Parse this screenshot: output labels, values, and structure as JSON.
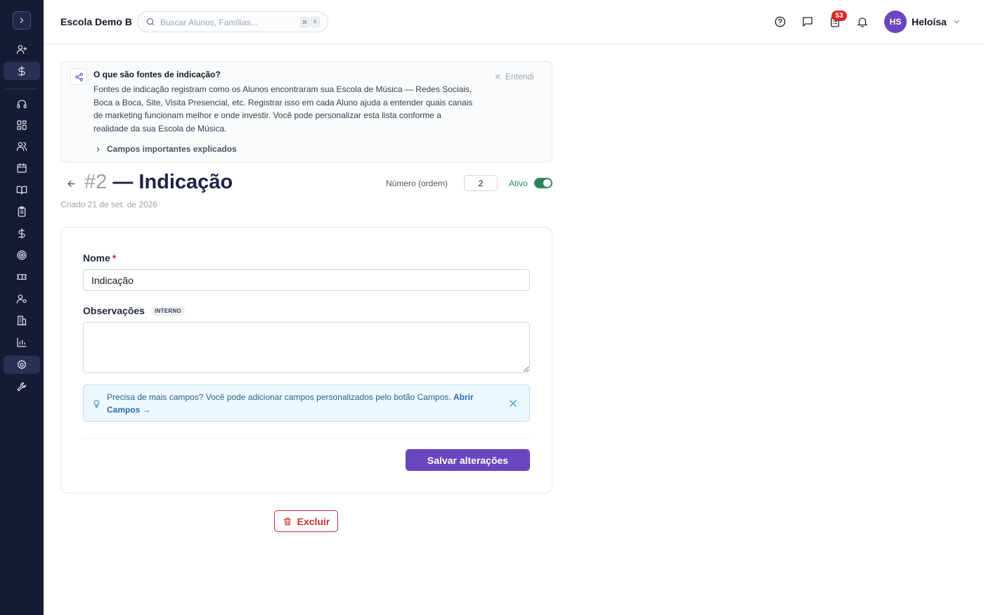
{
  "app": {
    "school_name": "Escola Demo B",
    "search_placeholder": "Buscar Alunos, Famílias...",
    "search_shortcut": [
      "⌘",
      "K"
    ],
    "notifications_count": "53",
    "user": {
      "initials": "HS",
      "name": "Heloísa",
      "avatar_color": "#6b46c1"
    }
  },
  "sidebar": {
    "items": [
      {
        "icon": "user-plus-icon"
      },
      {
        "icon": "dollar-icon"
      },
      {
        "icon": "headset-icon"
      },
      {
        "icon": "dashboard-grid-icon"
      },
      {
        "icon": "users-icon"
      },
      {
        "icon": "calendar-icon"
      },
      {
        "icon": "book-open-icon"
      },
      {
        "icon": "clipboard-icon"
      },
      {
        "icon": "dollar-icon"
      },
      {
        "icon": "target-icon"
      },
      {
        "icon": "ticket-icon"
      },
      {
        "icon": "user-settings-icon"
      },
      {
        "icon": "building-icon"
      },
      {
        "icon": "bar-chart-icon"
      },
      {
        "icon": "gear-icon",
        "active": true
      },
      {
        "icon": "wrench-icon"
      }
    ]
  },
  "info_banner": {
    "title": "O que são fontes de indicação?",
    "body": "Fontes de indicação registram como os Alunos encontraram sua Escola de Música — Redes Sociais, Boca a Boca, Site, Visita Presencial, etc. Registrar isso em cada Aluno ajuda a entender quais canais de marketing funcionam melhor e onde investir. Você pode personalizar esta lista conforme a realidade da sua Escola de Música.",
    "dismiss_label": "Entendi",
    "expand_label": "Campos importantes explicados"
  },
  "record": {
    "number": "#2",
    "title": "— Indicação",
    "created": "Criado 21 de set. de 2026",
    "order_label": "Número (ordem)",
    "order_value": "2",
    "active_label": "Ativo",
    "active": true
  },
  "form": {
    "nome_label": "Nome",
    "nome_required": "*",
    "nome_value": "Indicação",
    "obs_label": "Observações",
    "obs_tag": "INTERNO",
    "obs_value": "",
    "tip_text": "Precisa de mais campos? Você pode adicionar campos personalizados pelo botão Campos.",
    "tip_link": "Abrir Campos →",
    "save_label": "Salvar alterações"
  },
  "actions": {
    "delete_label": "Excluir"
  },
  "colors": {
    "sidebar": "#171a35",
    "primary": "#6b46c1",
    "success": "#2f855a",
    "danger": "#c53030",
    "badge": "#dc2626"
  }
}
